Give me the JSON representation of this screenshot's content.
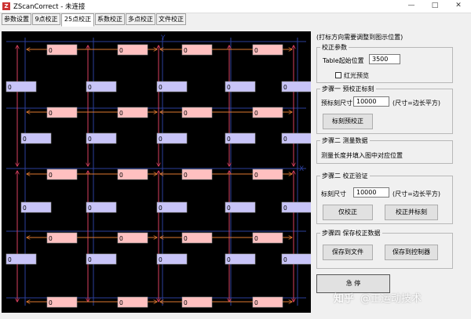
{
  "window": {
    "title": "ZScanCorrect - 未连接",
    "app_icon": "Z",
    "minimize_icon": "—",
    "maximize_icon": "□",
    "close_icon": "✕"
  },
  "tabs": [
    {
      "label": "参数设置"
    },
    {
      "label": "9点校正"
    },
    {
      "label": "25点校正",
      "active": true
    },
    {
      "label": "系数校正"
    },
    {
      "label": "多点校正"
    },
    {
      "label": "文件校正"
    }
  ],
  "canvas": {
    "axis_labels": {
      "y": "Y",
      "x": "X"
    },
    "colors": {
      "background": "#000000",
      "grid": "#2b3f9c",
      "orange_arrow": "#e07a30",
      "red_arrow": "#d84060",
      "pink_box": "#ffc0c0",
      "lavender_box": "#c8c4f8"
    },
    "h_boxes": [
      {
        "value": "0"
      },
      {
        "value": "0"
      },
      {
        "value": "0"
      },
      {
        "value": "0"
      },
      {
        "value": "0"
      },
      {
        "value": "0"
      },
      {
        "value": "0"
      },
      {
        "value": "0"
      },
      {
        "value": "0"
      },
      {
        "value": "0"
      },
      {
        "value": "0"
      },
      {
        "value": "0"
      },
      {
        "value": "0"
      },
      {
        "value": "0"
      },
      {
        "value": "0"
      },
      {
        "value": "0"
      },
      {
        "value": "0"
      },
      {
        "value": "0"
      },
      {
        "value": "0"
      },
      {
        "value": "0"
      }
    ],
    "v_boxes": [
      {
        "value": "0"
      },
      {
        "value": "0"
      },
      {
        "value": "0"
      },
      {
        "value": "0"
      },
      {
        "value": "0"
      },
      {
        "value": "0"
      },
      {
        "value": "0"
      },
      {
        "value": "0"
      },
      {
        "value": "0"
      },
      {
        "value": "0"
      },
      {
        "value": "0"
      },
      {
        "value": "0"
      },
      {
        "value": "0"
      },
      {
        "value": "0"
      },
      {
        "value": "0"
      },
      {
        "value": "0"
      },
      {
        "value": "0"
      },
      {
        "value": "0"
      },
      {
        "value": "0"
      },
      {
        "value": "0"
      }
    ]
  },
  "panel": {
    "hint": "(打标方向需要调整到图示位置)",
    "correction_params": {
      "title": "校正参数",
      "table_start_label": "Table起始位置",
      "table_start_value": "3500",
      "red_preview_label": "红光预览",
      "red_preview_checked": false
    },
    "step1": {
      "title": "步骤一 预校正标刻",
      "size_label": "预标刻尺寸",
      "size_value": "10000",
      "size_unit": "(尺寸=边长平方)",
      "button": "标刻预校正"
    },
    "step2a": {
      "title": "步骤二 测量数据",
      "text": "测量长度并填入图中对应位置"
    },
    "step2b": {
      "title": "步骤二 校正验证",
      "size_label": "标刻尺寸",
      "size_value": "10000",
      "size_unit": "(尺寸=边长平方)",
      "correct_button": "仅校正",
      "correct_mark_button": "校正并标刻"
    },
    "step4": {
      "title": "步骤四 保存校正数据",
      "save_file_button": "保存到文件",
      "save_controller_button": "保存到控制器"
    },
    "estop_button": "急 停"
  },
  "watermark": {
    "logo": "知乎",
    "text": "@正运动技术"
  }
}
